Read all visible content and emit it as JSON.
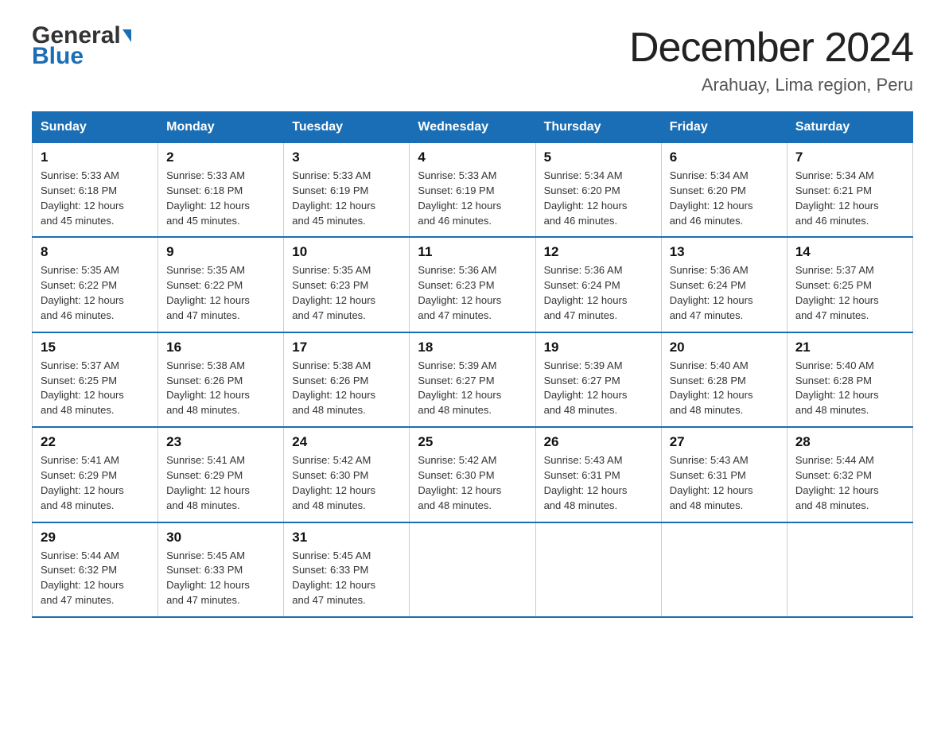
{
  "header": {
    "logo_general": "General",
    "logo_blue": "Blue",
    "month_title": "December 2024",
    "location": "Arahuay, Lima region, Peru"
  },
  "weekdays": [
    "Sunday",
    "Monday",
    "Tuesday",
    "Wednesday",
    "Thursday",
    "Friday",
    "Saturday"
  ],
  "weeks": [
    [
      {
        "day": "1",
        "sunrise": "5:33 AM",
        "sunset": "6:18 PM",
        "daylight": "12 hours and 45 minutes."
      },
      {
        "day": "2",
        "sunrise": "5:33 AM",
        "sunset": "6:18 PM",
        "daylight": "12 hours and 45 minutes."
      },
      {
        "day": "3",
        "sunrise": "5:33 AM",
        "sunset": "6:19 PM",
        "daylight": "12 hours and 45 minutes."
      },
      {
        "day": "4",
        "sunrise": "5:33 AM",
        "sunset": "6:19 PM",
        "daylight": "12 hours and 46 minutes."
      },
      {
        "day": "5",
        "sunrise": "5:34 AM",
        "sunset": "6:20 PM",
        "daylight": "12 hours and 46 minutes."
      },
      {
        "day": "6",
        "sunrise": "5:34 AM",
        "sunset": "6:20 PM",
        "daylight": "12 hours and 46 minutes."
      },
      {
        "day": "7",
        "sunrise": "5:34 AM",
        "sunset": "6:21 PM",
        "daylight": "12 hours and 46 minutes."
      }
    ],
    [
      {
        "day": "8",
        "sunrise": "5:35 AM",
        "sunset": "6:22 PM",
        "daylight": "12 hours and 46 minutes."
      },
      {
        "day": "9",
        "sunrise": "5:35 AM",
        "sunset": "6:22 PM",
        "daylight": "12 hours and 47 minutes."
      },
      {
        "day": "10",
        "sunrise": "5:35 AM",
        "sunset": "6:23 PM",
        "daylight": "12 hours and 47 minutes."
      },
      {
        "day": "11",
        "sunrise": "5:36 AM",
        "sunset": "6:23 PM",
        "daylight": "12 hours and 47 minutes."
      },
      {
        "day": "12",
        "sunrise": "5:36 AM",
        "sunset": "6:24 PM",
        "daylight": "12 hours and 47 minutes."
      },
      {
        "day": "13",
        "sunrise": "5:36 AM",
        "sunset": "6:24 PM",
        "daylight": "12 hours and 47 minutes."
      },
      {
        "day": "14",
        "sunrise": "5:37 AM",
        "sunset": "6:25 PM",
        "daylight": "12 hours and 47 minutes."
      }
    ],
    [
      {
        "day": "15",
        "sunrise": "5:37 AM",
        "sunset": "6:25 PM",
        "daylight": "12 hours and 48 minutes."
      },
      {
        "day": "16",
        "sunrise": "5:38 AM",
        "sunset": "6:26 PM",
        "daylight": "12 hours and 48 minutes."
      },
      {
        "day": "17",
        "sunrise": "5:38 AM",
        "sunset": "6:26 PM",
        "daylight": "12 hours and 48 minutes."
      },
      {
        "day": "18",
        "sunrise": "5:39 AM",
        "sunset": "6:27 PM",
        "daylight": "12 hours and 48 minutes."
      },
      {
        "day": "19",
        "sunrise": "5:39 AM",
        "sunset": "6:27 PM",
        "daylight": "12 hours and 48 minutes."
      },
      {
        "day": "20",
        "sunrise": "5:40 AM",
        "sunset": "6:28 PM",
        "daylight": "12 hours and 48 minutes."
      },
      {
        "day": "21",
        "sunrise": "5:40 AM",
        "sunset": "6:28 PM",
        "daylight": "12 hours and 48 minutes."
      }
    ],
    [
      {
        "day": "22",
        "sunrise": "5:41 AM",
        "sunset": "6:29 PM",
        "daylight": "12 hours and 48 minutes."
      },
      {
        "day": "23",
        "sunrise": "5:41 AM",
        "sunset": "6:29 PM",
        "daylight": "12 hours and 48 minutes."
      },
      {
        "day": "24",
        "sunrise": "5:42 AM",
        "sunset": "6:30 PM",
        "daylight": "12 hours and 48 minutes."
      },
      {
        "day": "25",
        "sunrise": "5:42 AM",
        "sunset": "6:30 PM",
        "daylight": "12 hours and 48 minutes."
      },
      {
        "day": "26",
        "sunrise": "5:43 AM",
        "sunset": "6:31 PM",
        "daylight": "12 hours and 48 minutes."
      },
      {
        "day": "27",
        "sunrise": "5:43 AM",
        "sunset": "6:31 PM",
        "daylight": "12 hours and 48 minutes."
      },
      {
        "day": "28",
        "sunrise": "5:44 AM",
        "sunset": "6:32 PM",
        "daylight": "12 hours and 48 minutes."
      }
    ],
    [
      {
        "day": "29",
        "sunrise": "5:44 AM",
        "sunset": "6:32 PM",
        "daylight": "12 hours and 47 minutes."
      },
      {
        "day": "30",
        "sunrise": "5:45 AM",
        "sunset": "6:33 PM",
        "daylight": "12 hours and 47 minutes."
      },
      {
        "day": "31",
        "sunrise": "5:45 AM",
        "sunset": "6:33 PM",
        "daylight": "12 hours and 47 minutes."
      },
      null,
      null,
      null,
      null
    ]
  ],
  "labels": {
    "sunrise": "Sunrise:",
    "sunset": "Sunset:",
    "daylight": "Daylight:"
  }
}
